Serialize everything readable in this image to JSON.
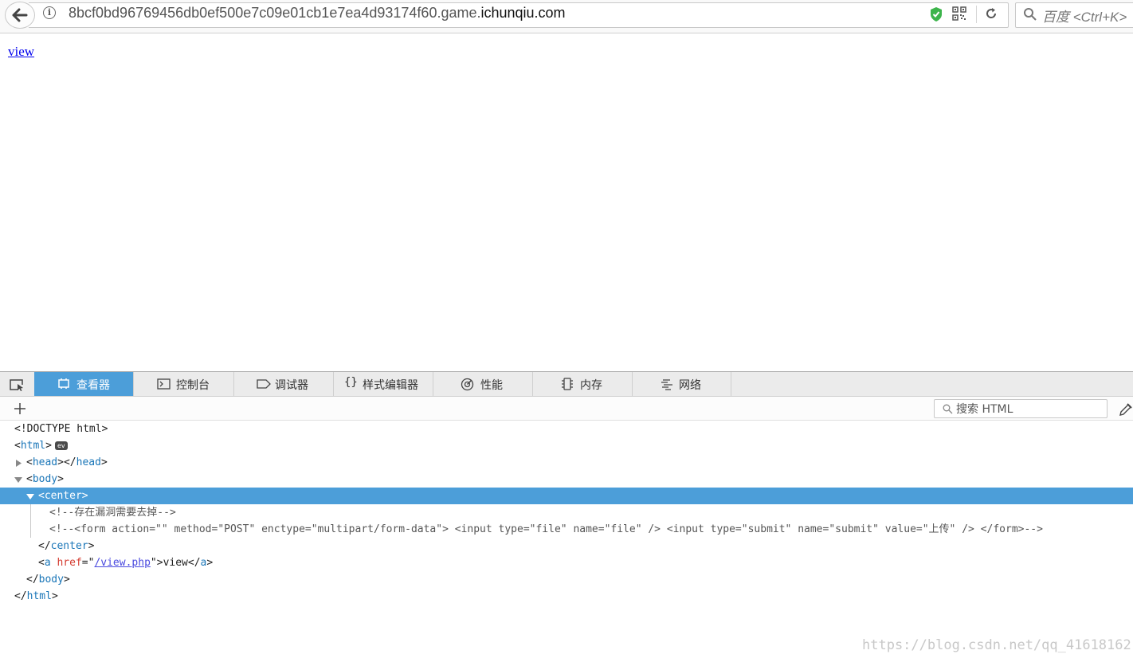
{
  "browser": {
    "url_prefix": "8bcf0bd96769456db0ef500e7c09e01cb1e7ea4d93174f60.game.",
    "url_host": "ichunqiu.com",
    "search_placeholder": "百度 <Ctrl+K>",
    "icons": {
      "back": "back-arrow-icon",
      "info": "info-icon",
      "shield": "shield-icon",
      "qr": "qr-code-icon",
      "reload": "reload-icon",
      "search": "search-icon"
    },
    "colors": {
      "shield": "#3cb44b"
    }
  },
  "page": {
    "link_label": "view",
    "link_color": "#0000ee"
  },
  "devtools": {
    "tabs": [
      {
        "label": "查看器",
        "icon": "inspector-icon",
        "selected": true
      },
      {
        "label": "控制台",
        "icon": "console-icon"
      },
      {
        "label": "调试器",
        "icon": "debugger-icon"
      },
      {
        "label": "样式编辑器",
        "icon": "style-editor-icon"
      },
      {
        "label": "性能",
        "icon": "performance-icon"
      },
      {
        "label": "内存",
        "icon": "memory-icon"
      },
      {
        "label": "网络",
        "icon": "network-icon"
      }
    ],
    "search_placeholder": "搜索 HTML",
    "selected_color": "#4c9ed9",
    "markup": {
      "doctype": "<!DOCTYPE html>",
      "html_open": "html",
      "ev_badge": "ev",
      "head_tag": "head",
      "body_tag": "body",
      "center_tag": "center",
      "comment_1": "<!--存在漏洞需要去掉-->",
      "comment_2": "<!--<form action=\"\" method=\"POST\" enctype=\"multipart/form-data\"> <input type=\"file\" name=\"file\" /> <input type=\"submit\" name=\"submit\" value=\"上传\" /> </form>-->",
      "a_tag": "a",
      "a_attr_name": "href",
      "a_attr_value": "/view.php",
      "a_text": "view"
    }
  },
  "watermark": "https://blog.csdn.net/qq_41618162"
}
